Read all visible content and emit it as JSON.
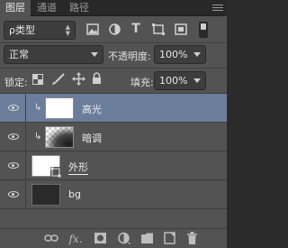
{
  "tabs": [
    {
      "label": "图层",
      "active": true
    },
    {
      "label": "通道",
      "active": false
    },
    {
      "label": "路径",
      "active": false
    }
  ],
  "filter": {
    "kind_label": "ρ类型",
    "icons": [
      "image-filter-icon",
      "adjustment-filter-icon",
      "type-filter-icon",
      "shape-filter-icon",
      "smart-object-filter-icon"
    ],
    "type_glyph": "T"
  },
  "blend": {
    "mode": "正常",
    "opacity_label": "不透明度:",
    "opacity_value": "100%"
  },
  "lock": {
    "label": "锁定:",
    "fill_label": "填充:",
    "fill_value": "100%"
  },
  "layers": [
    {
      "name": "高光",
      "clipped": true,
      "selected": true
    },
    {
      "name": "暗调",
      "clipped": true,
      "selected": false
    },
    {
      "name": "外形",
      "clipped": false,
      "selected": false
    },
    {
      "name": "bg",
      "clipped": false,
      "selected": false
    }
  ],
  "bottom_icons": {
    "fx": "fx."
  },
  "colors": {
    "panel": "#535353",
    "selected_layer": "#6a7e9b",
    "field": "#3d3d3d"
  }
}
